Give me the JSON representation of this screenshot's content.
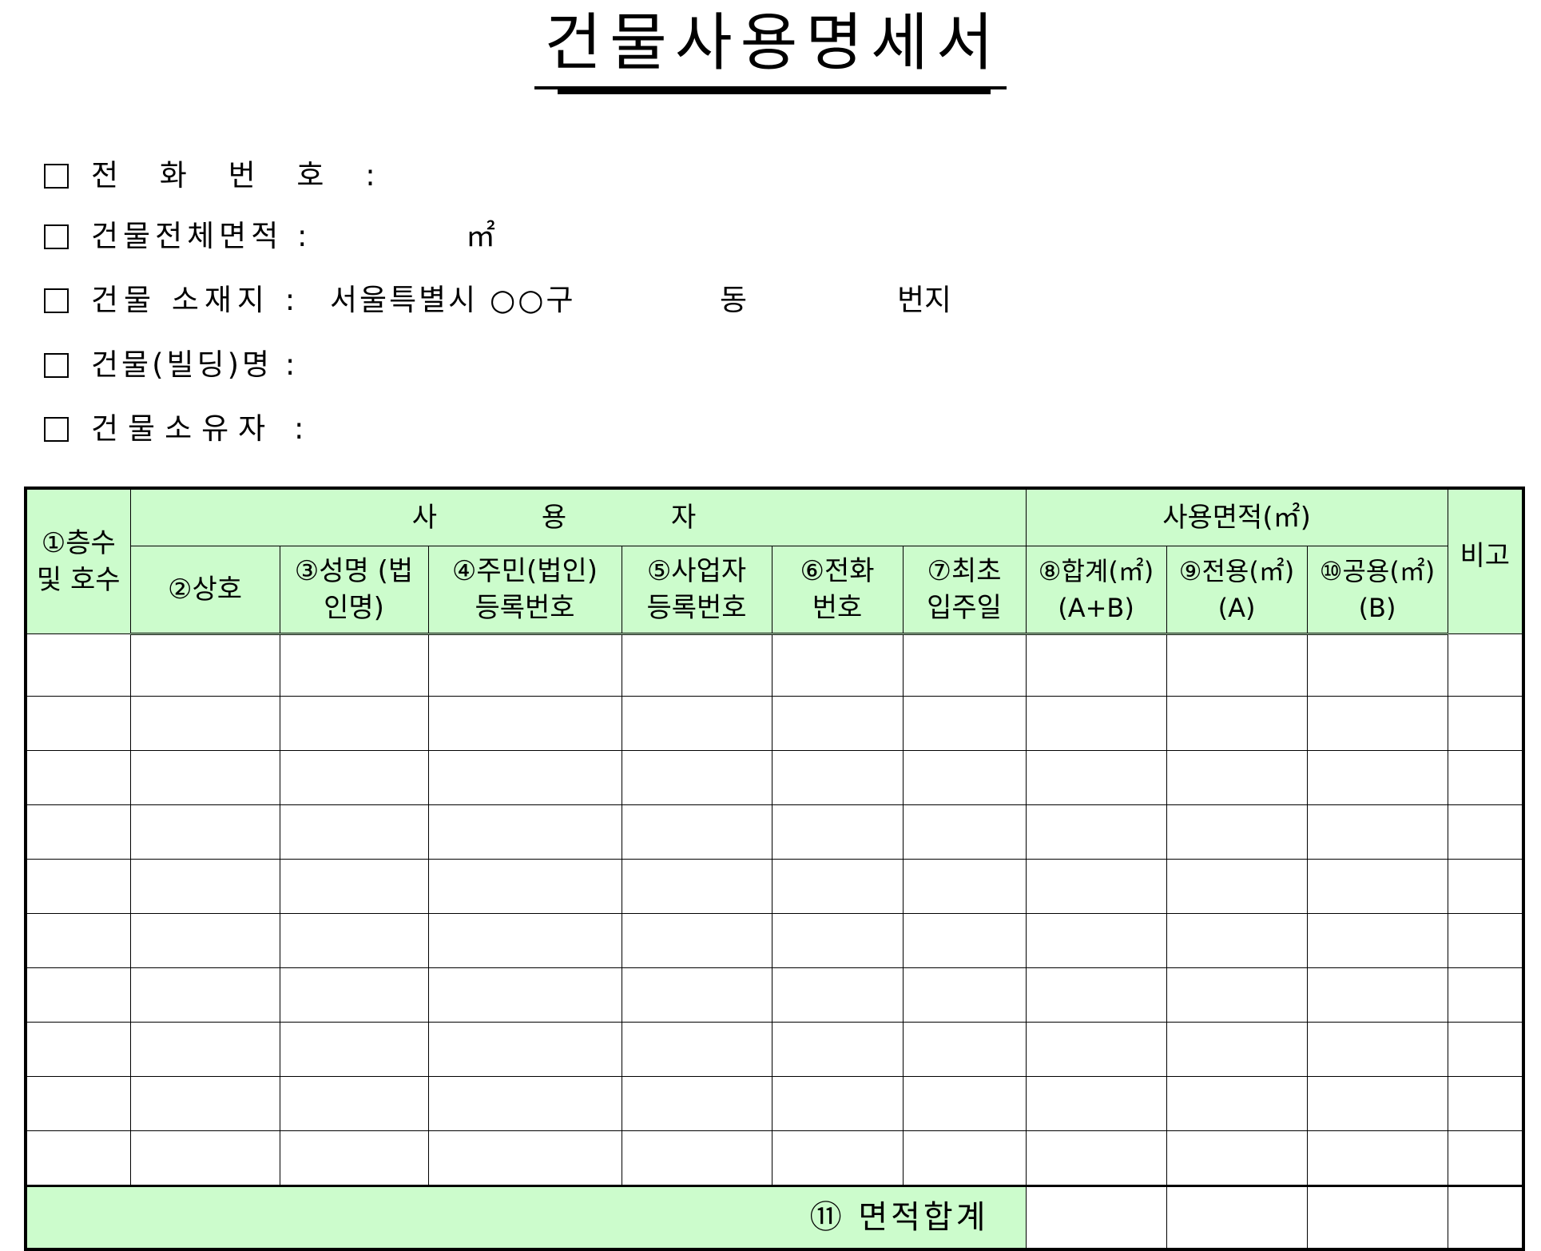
{
  "document": {
    "title": "건물사용명세서"
  },
  "info": {
    "phone_label": "전 화 번 호 :",
    "area_label": "건물전체면적 :",
    "area_unit": "㎡",
    "location_label": "건물 소재지 :",
    "location_city": "서울특별시 ○○구",
    "location_dong": "동",
    "location_beonji": "번지",
    "building_name_label": "건물(빌딩)명 :",
    "owner_label": "건물소유자 :"
  },
  "table": {
    "headers": {
      "floor": "①층수 및 호수",
      "user_group": "사 용 자",
      "area_group": "사용면적(㎡)",
      "remarks": "비고",
      "trade_name": "②상호",
      "name": "③성명 (법인명)",
      "resident_no": "④주민(법인) 등록번호",
      "business_no": "⑤사업자 등록번호",
      "phone": "⑥전화 번호",
      "move_in": "⑦최초 입주일",
      "total": "⑧합계(㎡) (A+B)",
      "exclusive": "⑨전용(㎡) (A)",
      "common": "⑩공용(㎡) (B)"
    },
    "total_label": "⑪ 면적합계",
    "rows": [
      [
        "",
        "",
        "",
        "",
        "",
        "",
        "",
        "",
        "",
        "",
        ""
      ],
      [
        "",
        "",
        "",
        "",
        "",
        "",
        "",
        "",
        "",
        "",
        ""
      ],
      [
        "",
        "",
        "",
        "",
        "",
        "",
        "",
        "",
        "",
        "",
        ""
      ],
      [
        "",
        "",
        "",
        "",
        "",
        "",
        "",
        "",
        "",
        "",
        ""
      ],
      [
        "",
        "",
        "",
        "",
        "",
        "",
        "",
        "",
        "",
        "",
        ""
      ],
      [
        "",
        "",
        "",
        "",
        "",
        "",
        "",
        "",
        "",
        "",
        ""
      ],
      [
        "",
        "",
        "",
        "",
        "",
        "",
        "",
        "",
        "",
        "",
        ""
      ],
      [
        "",
        "",
        "",
        "",
        "",
        "",
        "",
        "",
        "",
        "",
        ""
      ],
      [
        "",
        "",
        "",
        "",
        "",
        "",
        "",
        "",
        "",
        "",
        ""
      ],
      [
        "",
        "",
        "",
        "",
        "",
        "",
        "",
        "",
        "",
        "",
        ""
      ]
    ]
  }
}
